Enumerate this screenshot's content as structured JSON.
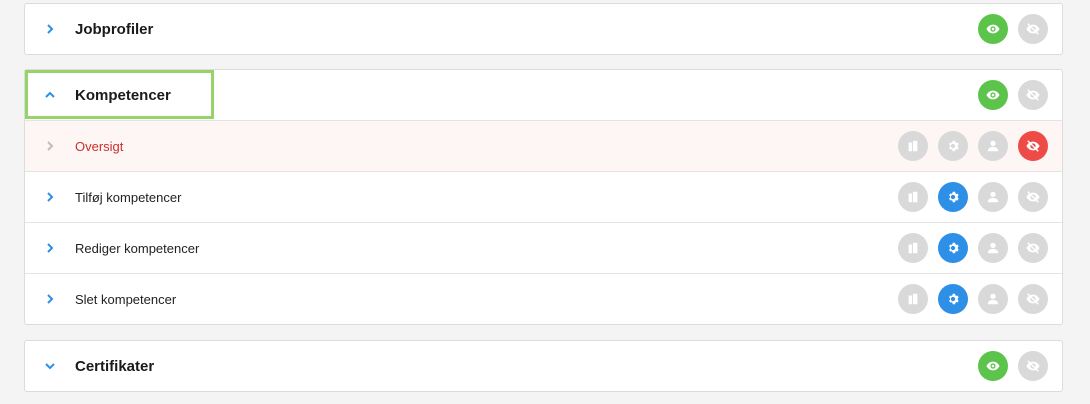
{
  "sections": {
    "jobprofiler": {
      "title": "Jobprofiler",
      "chevron": "chevron-right-icon",
      "icons": [
        "eye-icon",
        "eye-slash-icon"
      ]
    },
    "kompetencer": {
      "title": "Kompetencer",
      "chevron": "chevron-up-icon",
      "icons": [
        "eye-icon",
        "eye-slash-icon"
      ],
      "rows": [
        {
          "label": "Oversigt",
          "state": "active",
          "icons": [
            "building-icon",
            "gear-icon",
            "user-icon",
            "eye-slash-icon"
          ]
        },
        {
          "label": "Tilføj kompetencer",
          "icons": [
            "building-icon",
            "gear-icon",
            "user-icon",
            "eye-slash-icon"
          ]
        },
        {
          "label": "Rediger kompetencer",
          "icons": [
            "building-icon",
            "gear-icon",
            "user-icon",
            "eye-slash-icon"
          ]
        },
        {
          "label": "Slet kompetencer",
          "icons": [
            "building-icon",
            "gear-icon",
            "user-icon",
            "eye-slash-icon"
          ]
        }
      ]
    },
    "certifikater": {
      "title": "Certifikater",
      "chevron": "chevron-down-icon",
      "icons": [
        "eye-icon",
        "eye-slash-icon"
      ]
    }
  },
  "colors": {
    "accent_blue": "#2e8fe6",
    "visible_green": "#5cc44b",
    "hidden_red": "#ee4b47",
    "inactive_gray": "#d9d9d9",
    "active_row_text": "#c9302c",
    "selection_outline": "#97d26b"
  }
}
